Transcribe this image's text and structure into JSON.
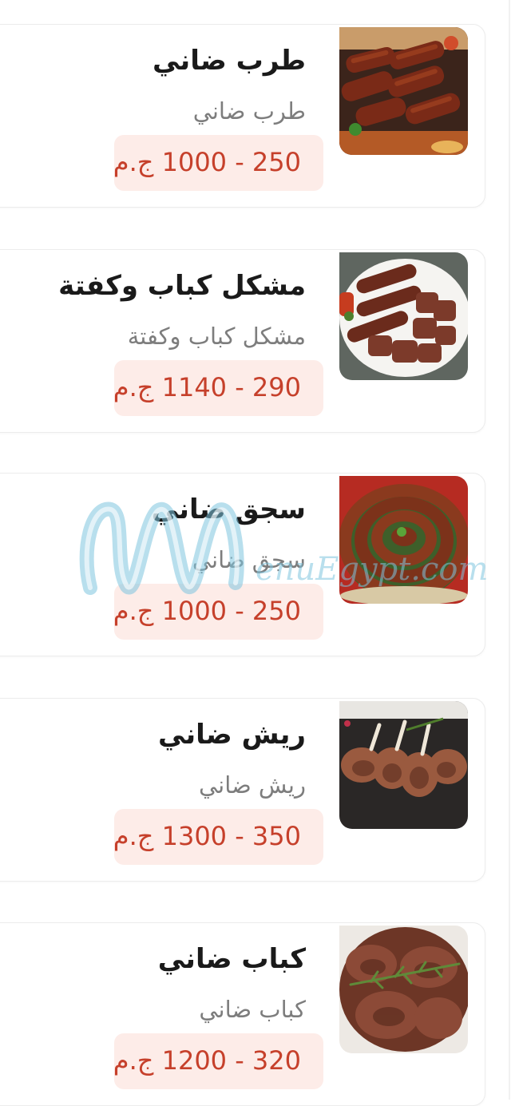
{
  "items": [
    {
      "name": "طرب ضاني",
      "description": "طرب ضاني",
      "price": "250 - 1000 ج.م"
    },
    {
      "name": "مشكل كباب وكفتة",
      "description": "مشكل كباب وكفتة",
      "price": "290 - 1140 ج.م"
    },
    {
      "name": "سجق ضاني",
      "description": "سجق ضاني",
      "price": "250 - 1000 ج.م"
    },
    {
      "name": "ريش ضاني",
      "description": "ريش ضاني",
      "price": "350 - 1300 ج.م"
    },
    {
      "name": "كباب ضاني",
      "description": "كباب ضاني",
      "price": "320 - 1200 ج.م"
    }
  ],
  "watermark": {
    "text": "enuEgypt.com"
  },
  "colors": {
    "price_text": "#c6402b",
    "price_bg": "#fdece8",
    "name_text": "#1a1a1a",
    "desc_text": "#7d7d7d",
    "watermark": "#7ec4de"
  }
}
